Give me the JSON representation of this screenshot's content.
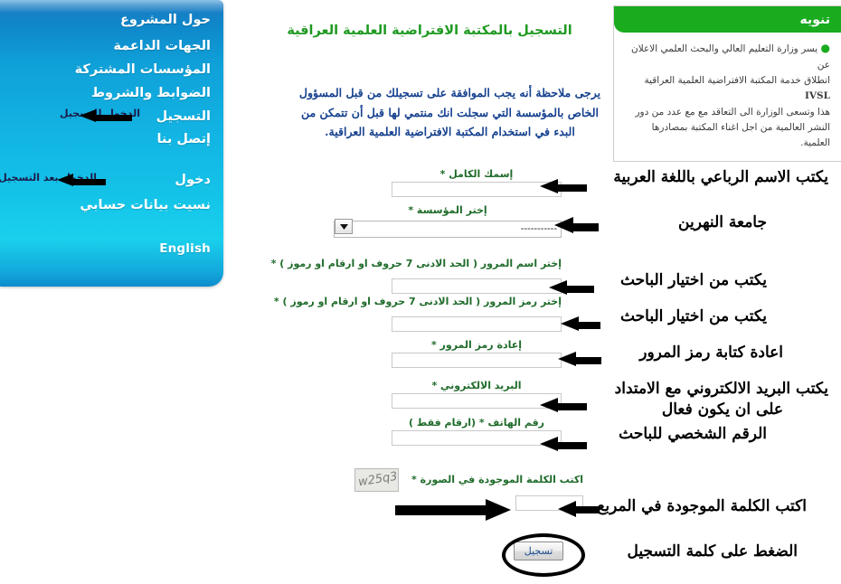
{
  "sidebar": {
    "items": [
      {
        "label": "حول المشروع",
        "name": "about-project"
      },
      {
        "label": "الجهات الداعمة",
        "name": "supporting-bodies"
      },
      {
        "label": "المؤسسات المشتركة",
        "name": "participating-institutions"
      },
      {
        "label": "الضوابط والشروط",
        "name": "rules-and-conditions"
      },
      {
        "label": "التسجيل",
        "name": "registration"
      },
      {
        "label": "إتصل بنا",
        "name": "contact-us"
      },
      {
        "label": "دخول",
        "name": "login"
      },
      {
        "label": "نسيت بيانات حسابي",
        "name": "forgot-account-data"
      },
      {
        "label": "English",
        "name": "english"
      }
    ],
    "annotations": [
      {
        "text": "الدخول للتسجيل",
        "name": "annotation-enter-to-register"
      },
      {
        "text": "الدخول بعد التسجيل",
        "name": "annotation-login-after-register"
      }
    ]
  },
  "notice": {
    "title": "تنويه",
    "bullet": "●",
    "line1": "يسر وزارة التعليم العالي والبحث العلمي الاعلان عن",
    "line2_pre": "اتطلاق خدمة المكتبة الافتراضية العلمية العراقية",
    "line2_acronym": "IVSL",
    "line3": "هذا وتسعى الوزارة الى التعاقد مع مع عدد من دور",
    "line4": "النشر العالمية من اجل اغناء المكتبة بمصادرها العلمية."
  },
  "main": {
    "title": "التسجيل بالمكتبة الافتراضية العلمية العراقية",
    "intro": "يرجى ملاحظة أنه يجب الموافقة على تسجيلك من قبل المسؤول الخاص بالمؤسسة التي سجلت انك منتمي لها قبل أن تتمكن من البدء في استخدام المكتبة الافتراضية العلمية العراقية."
  },
  "form": {
    "fields": [
      {
        "name": "full-name",
        "label": "إسمك الكامل *",
        "value": "",
        "type": "text"
      },
      {
        "name": "institution",
        "label": "إختر المؤسسة *",
        "value": "-----------",
        "type": "select"
      },
      {
        "name": "username",
        "label": "إختر اسم المرور ( الحد الادنى 7 حروف او ارقام او رموز ) *",
        "value": "",
        "type": "text"
      },
      {
        "name": "password",
        "label": "إختر رمز المرور ( الحد الادنى 7 حروف او ارقام او رموز ) *",
        "value": "",
        "type": "text"
      },
      {
        "name": "confirm-password",
        "label": "إعادة رمز المرور *",
        "value": "",
        "type": "text"
      },
      {
        "name": "email",
        "label": "البريد الالكتروني *",
        "value": "",
        "type": "text"
      },
      {
        "name": "phone",
        "label": "رقم الهاتف *  (ارقام فقط )",
        "value": "",
        "type": "text"
      },
      {
        "name": "captcha",
        "label": "اكتب الكلمة الموجودة في الصورة *",
        "value": "",
        "type": "text"
      }
    ],
    "captcha_image_text": "w25q3",
    "submit_label": "تسجيل"
  },
  "annotations": [
    {
      "name": "annot-full-name",
      "text": "يكتب الاسم الرباعي  باللغة العربية"
    },
    {
      "name": "annot-institution",
      "text": "جامعة النهرين"
    },
    {
      "name": "annot-username",
      "text": "يكتب من اختيار الباحث"
    },
    {
      "name": "annot-password",
      "text": "يكتب من اختيار الباحث"
    },
    {
      "name": "annot-confirm",
      "text": "اعادة كتابة رمز المرور"
    },
    {
      "name": "annot-email-l1",
      "text": "يكتب البريد الالكتروني مع الامتداد"
    },
    {
      "name": "annot-email-l2",
      "text": "على ان يكون فعال"
    },
    {
      "name": "annot-phone",
      "text": "الرقم الشخصي للباحث"
    },
    {
      "name": "annot-captcha",
      "text": "اكتب الكلمة الموجودة في المربع"
    },
    {
      "name": "annot-submit",
      "text": "الضغط على كلمة التسجيل"
    }
  ],
  "colors": {
    "sidebar_blue": "#12b2e2",
    "notice_green": "#1aab1f",
    "title_green": "#1f9a22",
    "label_green": "#1f6b2a",
    "intro_blue": "#16418f",
    "annotation_black": "#000000",
    "sidebar_note": "#1b1b4a"
  }
}
